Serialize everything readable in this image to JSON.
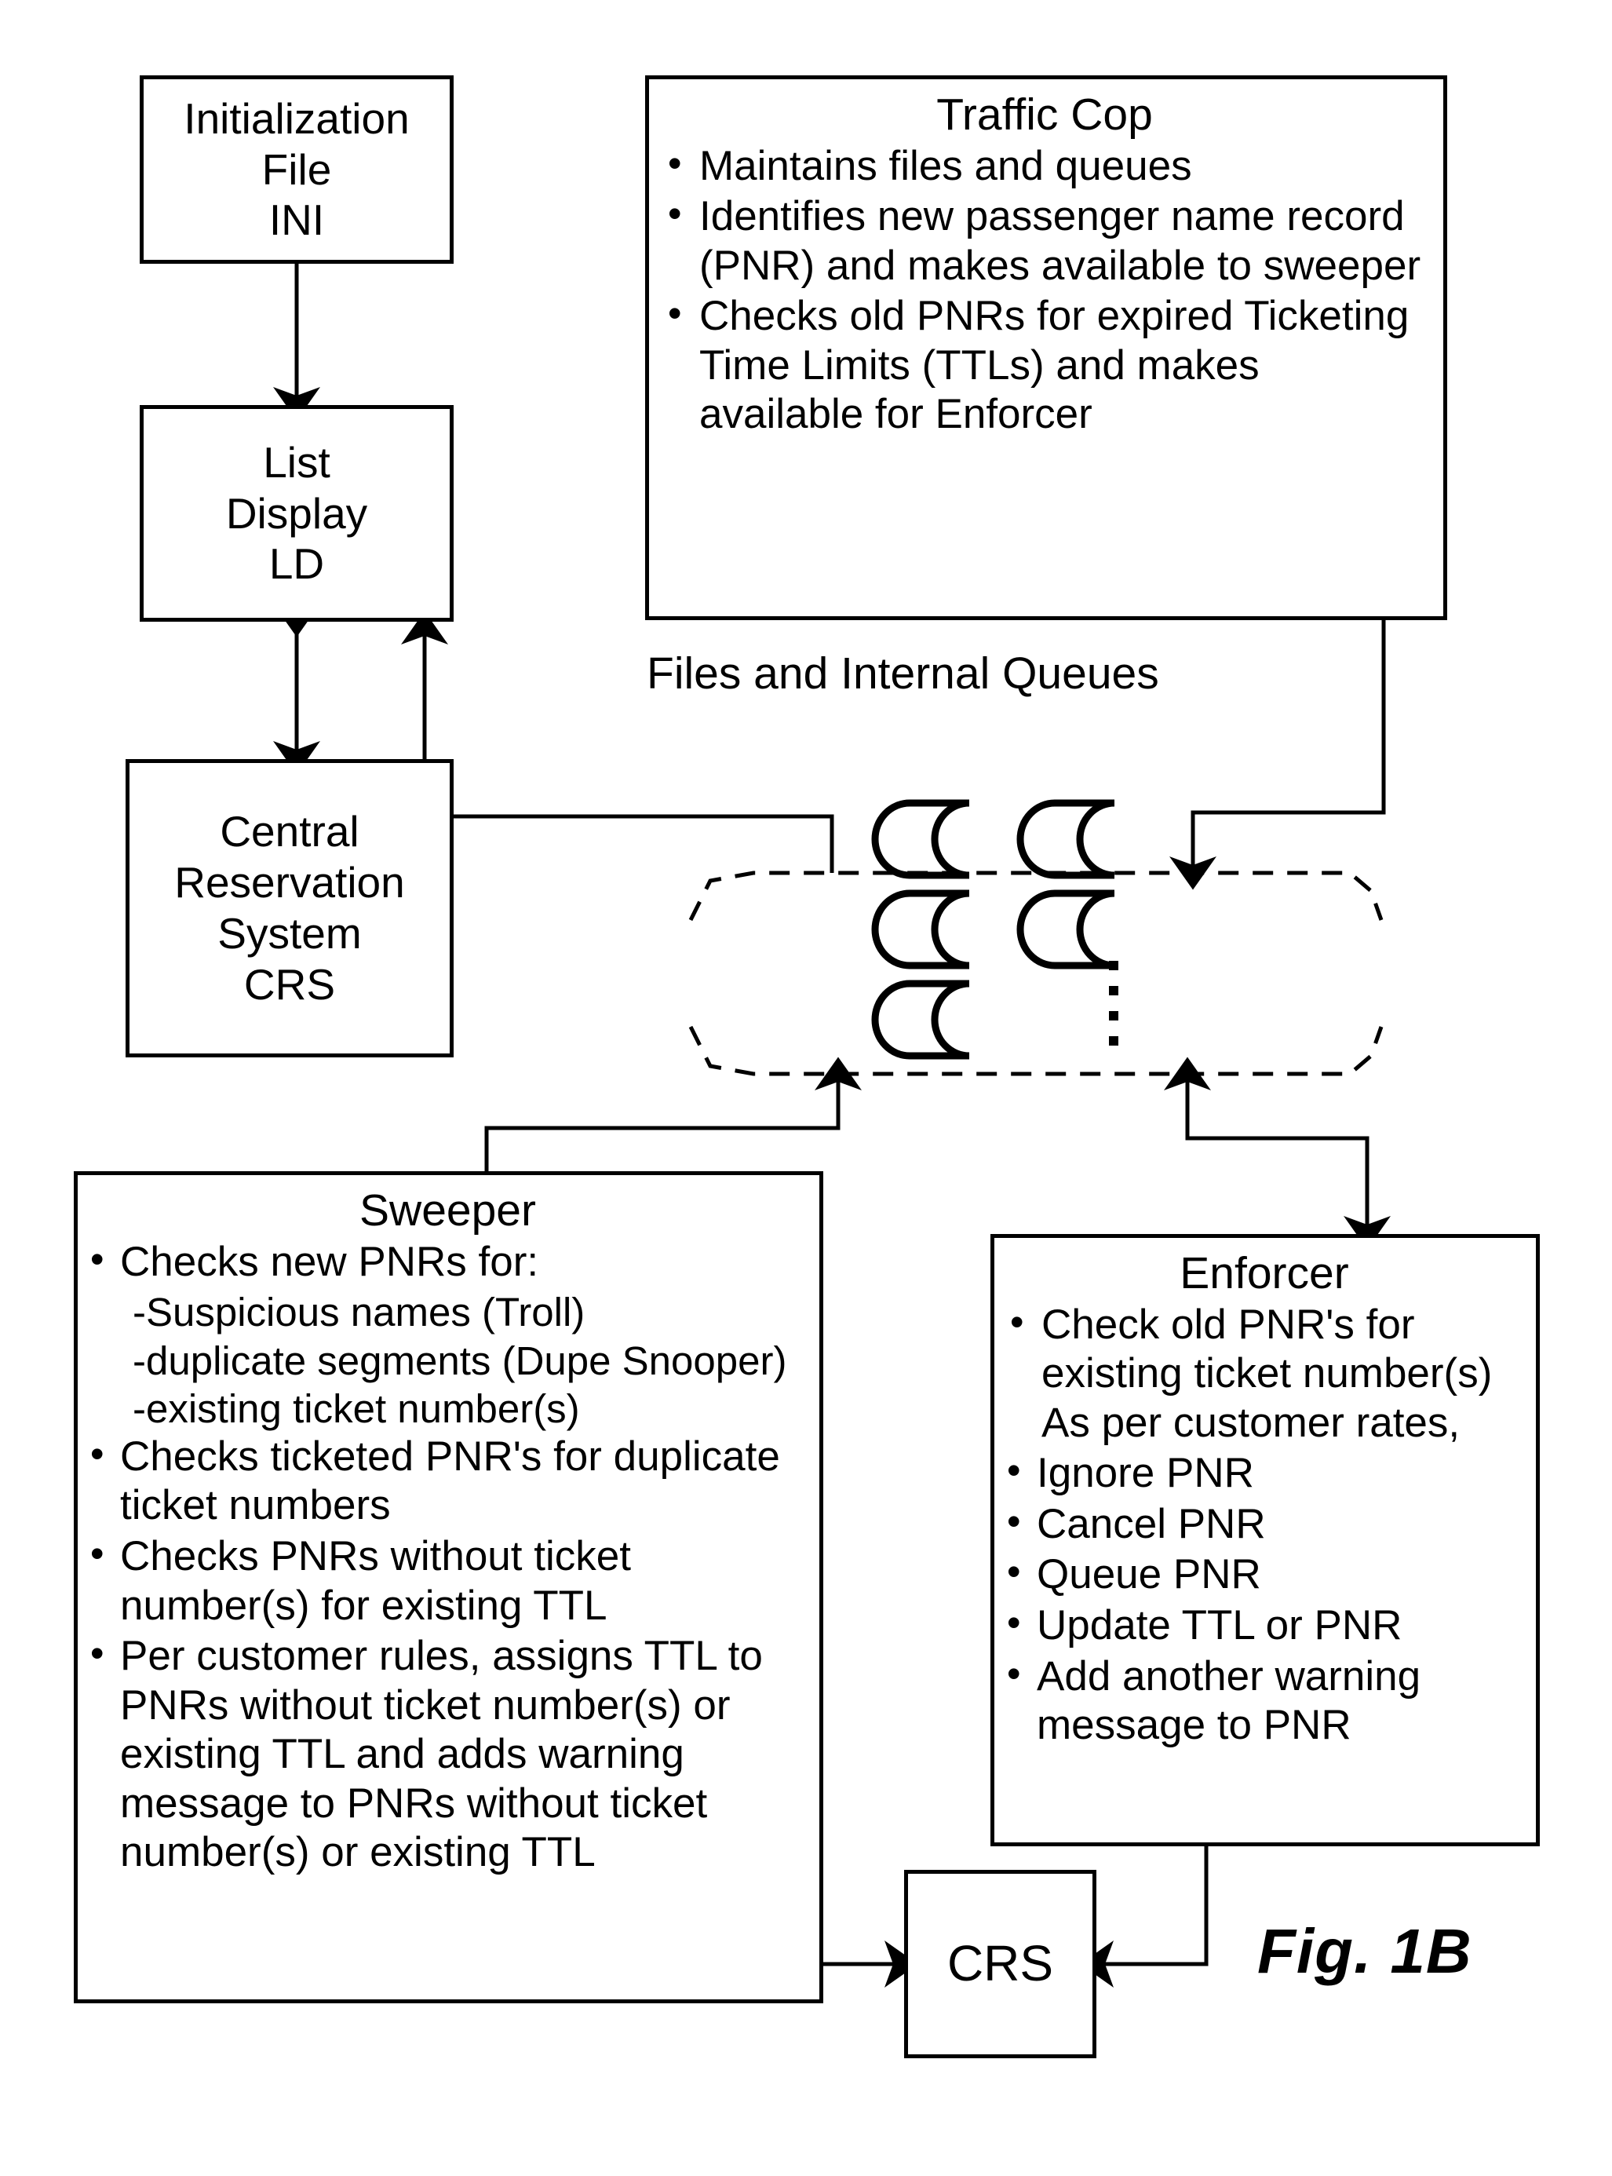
{
  "figure": {
    "label": "Fig. 1B",
    "caption_files_queues": "Files and Internal Queues"
  },
  "boxes": {
    "initialization_file": {
      "name": "Initialization File INI",
      "title": "Initialization\nFile\nINI"
    },
    "list_display": {
      "name": "List Display LD",
      "title": "List\nDisplay\nLD"
    },
    "central_reservation_system": {
      "name": "Central Reservation System CRS",
      "title": "Central\nReservation\nSystem\nCRS"
    },
    "traffic_cop": {
      "title": "Traffic Cop",
      "bullets": [
        "Maintains files and queues",
        "Identifies new passenger name record (PNR) and makes available to sweeper",
        "Checks old PNRs for expired Ticketing Time Limits (TTLs) and makes available for Enforcer"
      ]
    },
    "sweeper": {
      "title": "Sweeper",
      "bullets": [
        "Checks new PNRs for:",
        "Checks ticketed PNR's for duplicate ticket numbers",
        "Checks PNRs without ticket number(s) for existing TTL",
        "Per customer rules, assigns TTL to PNRs without ticket number(s) or existing TTL and adds warning message to PNRs without ticket number(s) or existing TTL"
      ],
      "sub_bullets": [
        "-Suspicious names (Troll)",
        "-duplicate segments (Dupe Snooper)",
        "-existing ticket number(s)"
      ]
    },
    "enforcer": {
      "title": "Enforcer",
      "bullets": [
        "Check old PNR's for existing ticket number(s) As per customer rates,",
        "Ignore PNR",
        "Cancel PNR",
        "Queue PNR",
        "Update TTL or PNR",
        "Add another warning message to PNR"
      ]
    },
    "crs_bottom": {
      "title": "CRS"
    }
  },
  "queue_cloud": {
    "name": "files-and-internal-queues-cloud",
    "queue_count_visible": 5,
    "ellipsis_dots": 3
  },
  "colors": {
    "stroke": "#000000",
    "background": "#ffffff"
  }
}
